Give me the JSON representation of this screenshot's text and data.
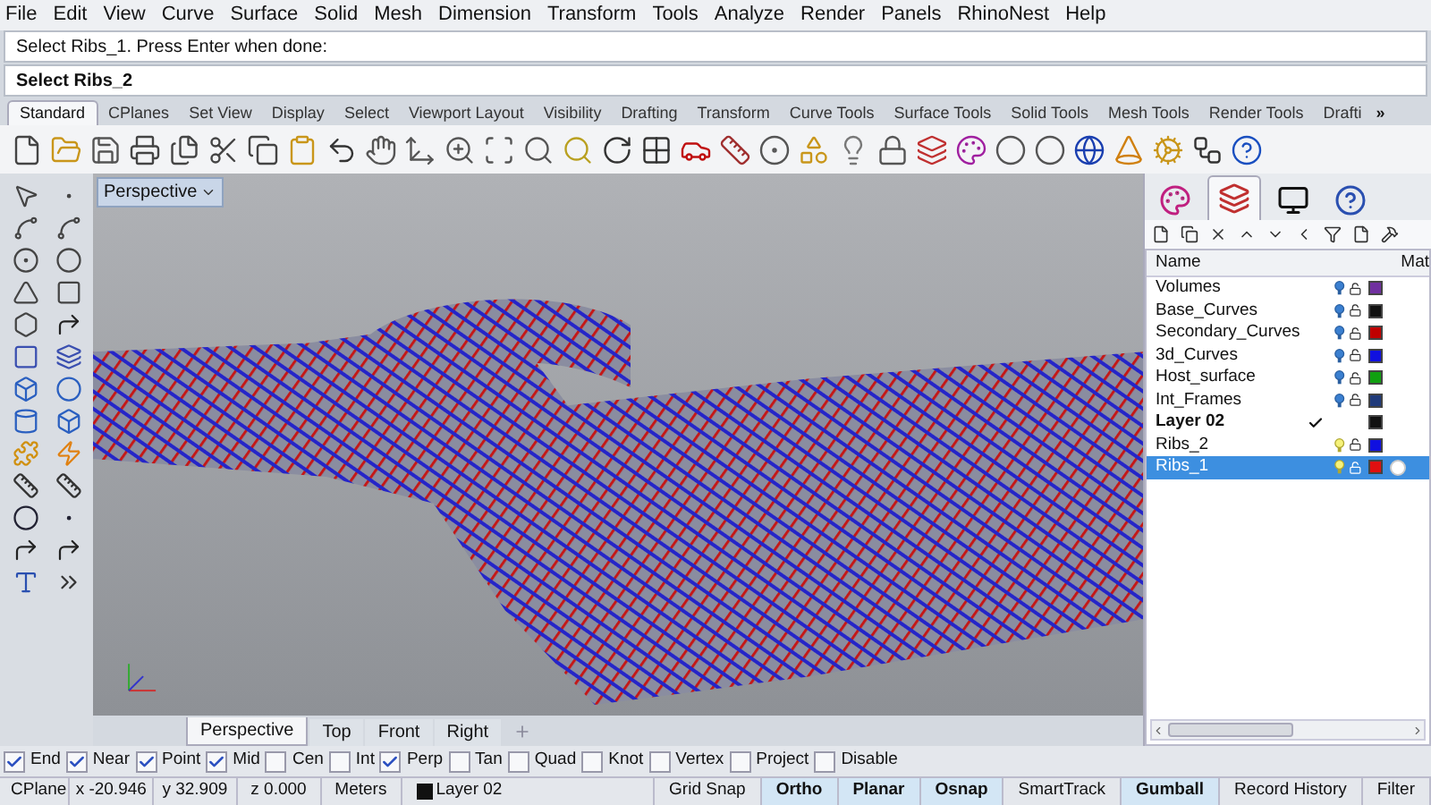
{
  "menu": [
    "File",
    "Edit",
    "View",
    "Curve",
    "Surface",
    "Solid",
    "Mesh",
    "Dimension",
    "Transform",
    "Tools",
    "Analyze",
    "Render",
    "Panels",
    "RhinoNest",
    "Help"
  ],
  "command": {
    "history": "Select Ribs_1. Press Enter when done:",
    "prompt": "Select Ribs_2"
  },
  "toolbar_tabs": [
    {
      "label": "Standard",
      "selected": true
    },
    {
      "label": "CPlanes",
      "selected": false
    },
    {
      "label": "Set View",
      "selected": false
    },
    {
      "label": "Display",
      "selected": false
    },
    {
      "label": "Select",
      "selected": false
    },
    {
      "label": "Viewport Layout",
      "selected": false
    },
    {
      "label": "Visibility",
      "selected": false
    },
    {
      "label": "Drafting",
      "selected": false
    },
    {
      "label": "Transform",
      "selected": false
    },
    {
      "label": "Curve Tools",
      "selected": false
    },
    {
      "label": "Surface Tools",
      "selected": false
    },
    {
      "label": "Solid Tools",
      "selected": false
    },
    {
      "label": "Mesh Tools",
      "selected": false
    },
    {
      "label": "Render Tools",
      "selected": false
    },
    {
      "label": "Drafti",
      "selected": false
    }
  ],
  "toolbar_more": "»",
  "viewport": {
    "title": "Perspective",
    "tabs": [
      {
        "label": "Perspective",
        "selected": true
      },
      {
        "label": "Top",
        "selected": false
      },
      {
        "label": "Front",
        "selected": false
      },
      {
        "label": "Right",
        "selected": false
      }
    ]
  },
  "panel_tabs": [
    {
      "selected": false
    },
    {
      "selected": true
    },
    {
      "selected": false
    },
    {
      "selected": false
    }
  ],
  "layers": {
    "columns": [
      "Name",
      "Mat"
    ],
    "rows": [
      {
        "name": "Volumes",
        "kind": "layer",
        "bulb_lit": false,
        "color": "#7030a0",
        "material": false,
        "selected": false
      },
      {
        "name": "Base_Curves",
        "kind": "layer",
        "bulb_lit": false,
        "color": "#111111",
        "material": false,
        "selected": false
      },
      {
        "name": "Secondary_Curves",
        "kind": "layer",
        "bulb_lit": false,
        "color": "#c00000",
        "material": false,
        "selected": false
      },
      {
        "name": "3d_Curves",
        "kind": "layer",
        "bulb_lit": false,
        "color": "#1010e0",
        "material": false,
        "selected": false
      },
      {
        "name": "Host_surface",
        "kind": "layer",
        "bulb_lit": false,
        "color": "#10a010",
        "material": false,
        "selected": false
      },
      {
        "name": "Int_Frames",
        "kind": "layer",
        "bulb_lit": false,
        "color": "#1f3a7a",
        "material": false,
        "selected": false
      },
      {
        "name": "Layer 02",
        "kind": "current",
        "color": "#111111",
        "material": false,
        "selected": false
      },
      {
        "name": "Ribs_2",
        "kind": "layer",
        "bulb_lit": true,
        "color": "#1010e0",
        "material": false,
        "selected": false
      },
      {
        "name": "Ribs_1",
        "kind": "layer",
        "bulb_lit": true,
        "color": "#e01010",
        "material": true,
        "selected": true
      }
    ]
  },
  "osnaps": [
    {
      "label": "End",
      "checked": true
    },
    {
      "label": "Near",
      "checked": true
    },
    {
      "label": "Point",
      "checked": true
    },
    {
      "label": "Mid",
      "checked": true
    },
    {
      "label": "Cen",
      "checked": false
    },
    {
      "label": "Int",
      "checked": false
    },
    {
      "label": "Perp",
      "checked": true
    },
    {
      "label": "Tan",
      "checked": false
    },
    {
      "label": "Quad",
      "checked": false
    },
    {
      "label": "Knot",
      "checked": false
    },
    {
      "label": "Vertex",
      "checked": false
    },
    {
      "label": "Project",
      "checked": false
    },
    {
      "label": "Disable",
      "checked": false
    }
  ],
  "status": {
    "cplane": "CPlane",
    "x": "x -20.946",
    "y": "y 32.909",
    "z": "z 0.000",
    "units": "Meters",
    "layer": "Layer 02",
    "toggles": [
      {
        "label": "Grid Snap",
        "on": false
      },
      {
        "label": "Ortho",
        "on": true
      },
      {
        "label": "Planar",
        "on": true
      },
      {
        "label": "Osnap",
        "on": true
      },
      {
        "label": "SmartTrack",
        "on": false
      },
      {
        "label": "Gumball",
        "on": true
      },
      {
        "label": "Record History",
        "on": false
      },
      {
        "label": "Filter",
        "on": false
      }
    ]
  }
}
